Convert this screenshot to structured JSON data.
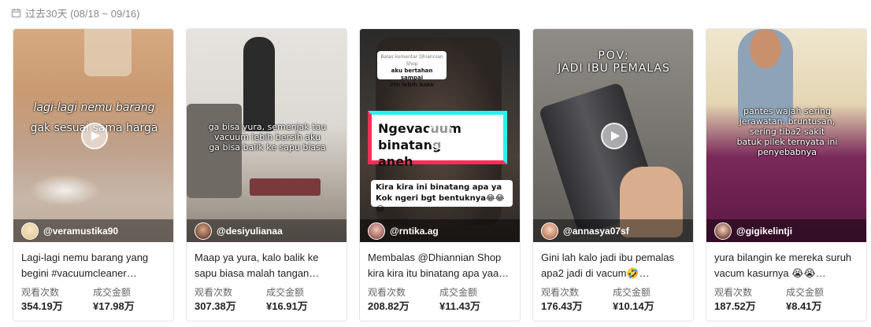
{
  "header": {
    "date_range": "过去30天 (08/18 ~ 09/16)"
  },
  "cards": [
    {
      "overlay_lines": [
        "lagi-lagi nemu barang",
        "gak sesuai sama harga"
      ],
      "author": "@veramustika90",
      "caption": "Lagi-lagi nemu barang yang begini #vacuumcleaner…",
      "views_label": "观看次数",
      "views": "354.19万",
      "gmv_label": "成交金额",
      "gmv": "¥17.98万"
    },
    {
      "overlay_lines": [
        "ga bisa yura, semenjak tau",
        "vacuum lebih bersih aku",
        "ga bisa balik ke sapu biasa"
      ],
      "author": "@desiyulianaa",
      "caption": "Maap ya yura, kalo balik ke sapu biasa malah tangan…",
      "views_label": "观看次数",
      "views": "307.38万",
      "gmv_label": "成交金额",
      "gmv": "¥16.91万"
    },
    {
      "overlay_lines": [
        "Ngevacuum binatang",
        "aneh"
      ],
      "reply_bubble": [
        "Balas komentar Dhiannian Shop",
        "aku bertahan sampai",
        "2th lebih kakk"
      ],
      "sub_box": [
        "Kira kira ini binatang apa ya",
        "Kok ngeri bgt bentuknya😂😂😂"
      ],
      "author": "@rntika.ag",
      "caption": "Membalas @Dhiannian Shop kira kira itu binatang apa yaa…",
      "views_label": "观看次数",
      "views": "208.82万",
      "gmv_label": "成交金额",
      "gmv": "¥11.43万"
    },
    {
      "overlay_lines": [
        "POV:",
        "JADI IBU PEMALAS"
      ],
      "author": "@annasya07sf",
      "caption": "Gini lah kalo jadi ibu pemalas apa2 jadi di vacum🤣…",
      "views_label": "观看次数",
      "views": "176.43万",
      "gmv_label": "成交金额",
      "gmv": "¥10.14万"
    },
    {
      "overlay_lines": [
        "pantes wajah sering",
        "jerawatan, bruntusan,",
        "sering tiba2 sakit",
        "batuk pilek ternyata ini",
        "penyebabnya"
      ],
      "author": "@gigikelintji",
      "caption": "yura bilangin ke mereka suruh vacum kasurnya 😭😭…",
      "views_label": "观看次数",
      "views": "187.52万",
      "gmv_label": "成交金额",
      "gmv": "¥8.41万"
    }
  ],
  "colors": {
    "tiktok_red": "#ff2d55",
    "tiktok_cyan": "#25f4ee"
  },
  "icons": {
    "date": "calendar-icon",
    "play": "play-icon"
  }
}
